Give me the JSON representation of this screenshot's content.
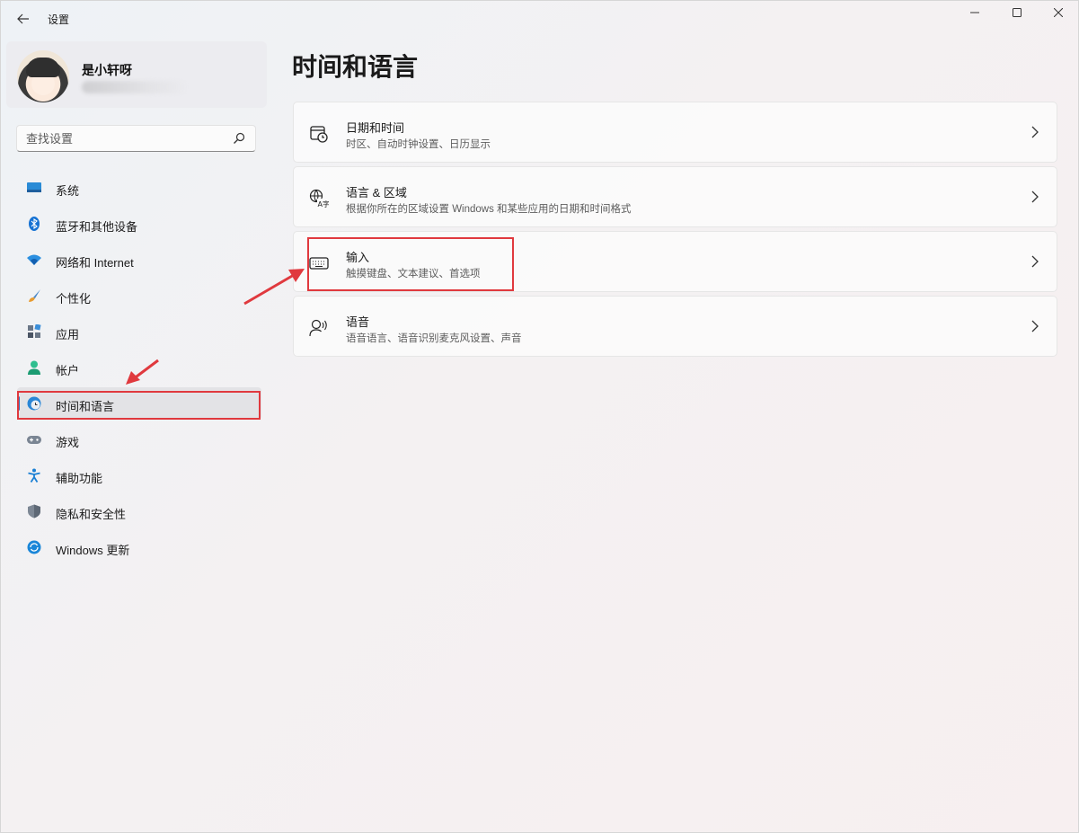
{
  "window": {
    "title": "设置",
    "back_icon": "back-arrow-icon",
    "controls": [
      "minimize-icon",
      "maximize-icon",
      "close-icon"
    ]
  },
  "profile": {
    "name": "是小轩呀"
  },
  "search": {
    "placeholder": "查找设置"
  },
  "nav": {
    "items": [
      {
        "label": "系统",
        "icon": "monitor-icon"
      },
      {
        "label": "蓝牙和其他设备",
        "icon": "bluetooth-icon"
      },
      {
        "label": "网络和 Internet",
        "icon": "wifi-icon"
      },
      {
        "label": "个性化",
        "icon": "brush-icon"
      },
      {
        "label": "应用",
        "icon": "apps-icon"
      },
      {
        "label": "帐户",
        "icon": "account-icon"
      },
      {
        "label": "时间和语言",
        "icon": "time-language-icon",
        "selected": true
      },
      {
        "label": "游戏",
        "icon": "gamepad-icon"
      },
      {
        "label": "辅助功能",
        "icon": "accessibility-icon"
      },
      {
        "label": "隐私和安全性",
        "icon": "shield-icon"
      },
      {
        "label": "Windows 更新",
        "icon": "update-icon"
      }
    ]
  },
  "page": {
    "title": "时间和语言"
  },
  "cards": [
    {
      "title": "日期和时间",
      "desc": "时区、自动时钟设置、日历显示",
      "icon": "calendar-clock-icon"
    },
    {
      "title": "语言 & 区域",
      "desc": "根据你所在的区域设置 Windows 和某些应用的日期和时间格式",
      "icon": "language-region-icon"
    },
    {
      "title": "输入",
      "desc": "触摸键盘、文本建议、首选项",
      "icon": "keyboard-icon"
    },
    {
      "title": "语音",
      "desc": "语音语言、语音识别麦克风设置、声音",
      "icon": "speech-icon"
    }
  ],
  "colors": {
    "accent": "#3a6fb6",
    "annotation": "#e0393e"
  }
}
